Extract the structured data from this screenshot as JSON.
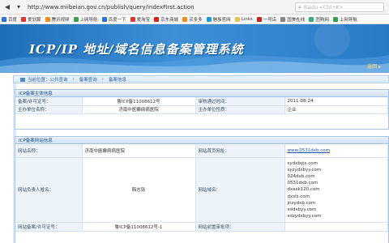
{
  "browser": {
    "url": "http://www.miibeian.gov.cn/publish/query/indexFirst.action",
    "search_placeholder": "Baidu <Ctrl+K>"
  },
  "bookmarks": [
    {
      "label": "百度",
      "color": "#2f6ee0"
    },
    {
      "label": "爱划算",
      "color": "#e0382e"
    },
    {
      "label": "腾讯视频",
      "color": "#f08c1a"
    },
    {
      "label": "上网导航",
      "color": "#2fa64a"
    },
    {
      "label": "百度一下",
      "color": "#2f6ee0"
    },
    {
      "label": "爱淘宝",
      "color": "#e0382e"
    },
    {
      "label": "京东商城",
      "color": "#d42222"
    },
    {
      "label": "买多多",
      "color": "#f08c1a"
    },
    {
      "label": "魅族官网",
      "color": "#1b9ee0"
    },
    {
      "label": "Links",
      "color": "#e8c24a"
    },
    {
      "label": "一号店",
      "color": "#c22"
    },
    {
      "label": "国美在线",
      "color": "#888"
    },
    {
      "label": "团购网",
      "color": "#3a8"
    },
    {
      "label": "上网导航",
      "color": "#2fa64a"
    }
  ],
  "banner": {
    "title": "ICP/IP 地址/域名信息备案管理系统",
    "link": "返回 ▸"
  },
  "breadcrumb": [
    "当前位置：公共查询",
    "备案查询",
    "备案信息"
  ],
  "sponsor": {
    "title": "ICP备案主体信息",
    "rows": [
      [
        "备案/许可证号：",
        "鲁ICP备11008612号",
        "审核通过时间：",
        "2011-08-24"
      ],
      [
        "主办单位名称：",
        "济南中医癫痫病医院",
        "主办单位性质：",
        "企业"
      ]
    ]
  },
  "website": {
    "title": "ICP备案网站信息",
    "name_label": "网站名称：",
    "name_value": "济南中医癫痫病医院",
    "homepage_label": "网站首页网址：",
    "homepage_value": "www.0531dxb.com",
    "owner_label": "网站负责人姓名：",
    "owner_value": "韩志铄",
    "domain_label": "网站域名：",
    "domains": [
      "sydxbyjs.com",
      "syzydxbyy.com",
      "024dxb.com",
      "0531dxb.com",
      "dxask120.com",
      "dxsls.com",
      "jnzydxb.com",
      "sddxbyy.com",
      "sdzydxbyy.com"
    ],
    "license_label": "网站备案/许可证号：",
    "license_value": "鲁ICP备11008612号-1",
    "preapproval_label": "网站前置审批项："
  }
}
